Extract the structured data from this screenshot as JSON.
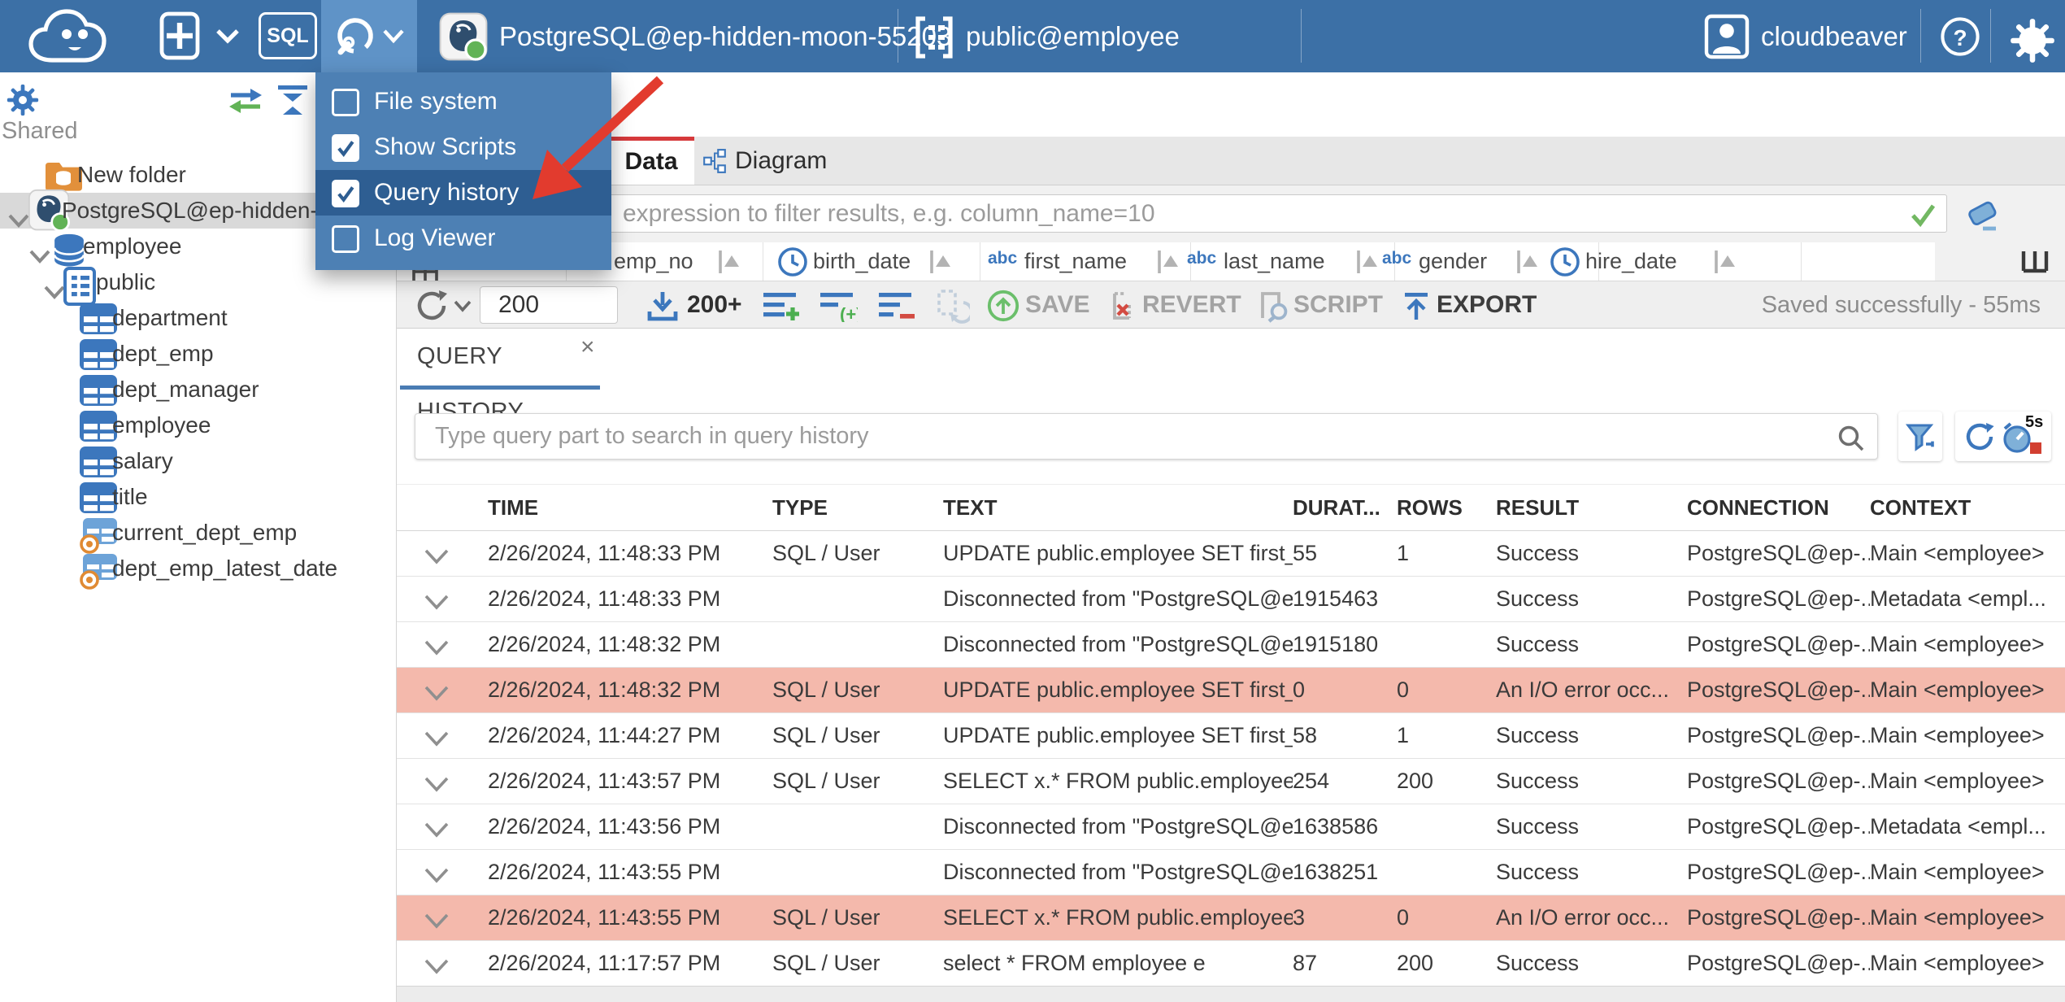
{
  "header": {
    "sql_button": "SQL",
    "connection_label": "PostgreSQL@ep-hidden-moon-55203",
    "schema_label": "public@employee",
    "user_label": "cloudbeaver"
  },
  "menu": {
    "items": [
      {
        "label": "File system",
        "checked": false,
        "highlighted": false
      },
      {
        "label": "Show Scripts",
        "checked": true,
        "highlighted": false
      },
      {
        "label": "Query history",
        "checked": true,
        "highlighted": true
      },
      {
        "label": "Log Viewer",
        "checked": false,
        "highlighted": false
      }
    ]
  },
  "sidebar": {
    "section_label": "Shared",
    "tree": [
      {
        "label": "New folder",
        "icon": "folder",
        "level": 0,
        "expander": false,
        "selected": false
      },
      {
        "label": "PostgreSQL@ep-hidden-",
        "icon": "postgres",
        "level": 0,
        "expander": true,
        "selected": true
      },
      {
        "label": "employee",
        "icon": "database",
        "level": 1,
        "expander": true,
        "selected": false
      },
      {
        "label": "public",
        "icon": "schema",
        "level": 2,
        "expander": true,
        "selected": false
      },
      {
        "label": "department",
        "icon": "table",
        "level": 3,
        "expander": false,
        "selected": false
      },
      {
        "label": "dept_emp",
        "icon": "table",
        "level": 3,
        "expander": false,
        "selected": false
      },
      {
        "label": "dept_manager",
        "icon": "table",
        "level": 3,
        "expander": false,
        "selected": false
      },
      {
        "label": "employee",
        "icon": "table",
        "level": 3,
        "expander": false,
        "selected": false
      },
      {
        "label": "salary",
        "icon": "table",
        "level": 3,
        "expander": false,
        "selected": false
      },
      {
        "label": "title",
        "icon": "table",
        "level": 3,
        "expander": false,
        "selected": false
      },
      {
        "label": "current_dept_emp",
        "icon": "view",
        "level": 3,
        "expander": false,
        "selected": false
      },
      {
        "label": "dept_emp_latest_date",
        "icon": "view",
        "level": 3,
        "expander": false,
        "selected": false
      }
    ]
  },
  "tabs": {
    "data_label": "Data",
    "diagram_label": "Diagram"
  },
  "filter": {
    "placeholder": "expression to filter results, e.g. column_name=10"
  },
  "grid": {
    "row_number_symbol": "#",
    "columns": [
      {
        "name": "emp_no",
        "type": "123"
      },
      {
        "name": "birth_date",
        "type": "date"
      },
      {
        "name": "first_name",
        "type": "abc"
      },
      {
        "name": "last_name",
        "type": "abc"
      },
      {
        "name": "gender",
        "type": "abc"
      },
      {
        "name": "hire_date",
        "type": "date"
      }
    ]
  },
  "toolbar": {
    "row_limit_value": "200",
    "fetch_size_label": "200+",
    "save_label": "SAVE",
    "revert_label": "REVERT",
    "script_label": "SCRIPT",
    "export_label": "EXPORT",
    "status_text": "Saved successfully - 55ms"
  },
  "history": {
    "tab_label": "QUERY HISTORY",
    "close_glyph": "×",
    "search_placeholder": "Type query part to search in query history",
    "timer_label": "5s",
    "columns": [
      "TIME",
      "TYPE",
      "TEXT",
      "DURAT...",
      "ROWS",
      "RESULT",
      "CONNECTION",
      "CONTEXT"
    ],
    "rows": [
      {
        "time": "2/26/2024, 11:48:33 PM",
        "type": "SQL / User",
        "text": "UPDATE public.employee SET first_...",
        "duration": "55",
        "rows": "1",
        "result": "Success",
        "connection": "PostgreSQL@ep-...",
        "context": "Main <employee>",
        "error": false
      },
      {
        "time": "2/26/2024, 11:48:33 PM",
        "type": "",
        "text": "Disconnected from \"PostgreSQL@e...",
        "duration": "1915463",
        "rows": "",
        "result": "Success",
        "connection": "PostgreSQL@ep-...",
        "context": "Metadata <empl...",
        "error": false
      },
      {
        "time": "2/26/2024, 11:48:32 PM",
        "type": "",
        "text": "Disconnected from \"PostgreSQL@e...",
        "duration": "1915180",
        "rows": "",
        "result": "Success",
        "connection": "PostgreSQL@ep-...",
        "context": "Main <employee>",
        "error": false
      },
      {
        "time": "2/26/2024, 11:48:32 PM",
        "type": "SQL / User",
        "text": "UPDATE public.employee SET first_...",
        "duration": "0",
        "rows": "0",
        "result": "An I/O error occ...",
        "connection": "PostgreSQL@ep-...",
        "context": "Main <employee>",
        "error": true
      },
      {
        "time": "2/26/2024, 11:44:27 PM",
        "type": "SQL / User",
        "text": "UPDATE public.employee SET first_...",
        "duration": "58",
        "rows": "1",
        "result": "Success",
        "connection": "PostgreSQL@ep-...",
        "context": "Main <employee>",
        "error": false
      },
      {
        "time": "2/26/2024, 11:43:57 PM",
        "type": "SQL / User",
        "text": "SELECT x.* FROM public.employee x",
        "duration": "254",
        "rows": "200",
        "result": "Success",
        "connection": "PostgreSQL@ep-...",
        "context": "Main <employee>",
        "error": false
      },
      {
        "time": "2/26/2024, 11:43:56 PM",
        "type": "",
        "text": "Disconnected from \"PostgreSQL@e...",
        "duration": "1638586",
        "rows": "",
        "result": "Success",
        "connection": "PostgreSQL@ep-...",
        "context": "Metadata <empl...",
        "error": false
      },
      {
        "time": "2/26/2024, 11:43:55 PM",
        "type": "",
        "text": "Disconnected from \"PostgreSQL@e...",
        "duration": "1638251",
        "rows": "",
        "result": "Success",
        "connection": "PostgreSQL@ep-...",
        "context": "Main <employee>",
        "error": false
      },
      {
        "time": "2/26/2024, 11:43:55 PM",
        "type": "SQL / User",
        "text": "SELECT x.* FROM public.employee x",
        "duration": "3",
        "rows": "0",
        "result": "An I/O error occ...",
        "connection": "PostgreSQL@ep-...",
        "context": "Main <employee>",
        "error": true
      },
      {
        "time": "2/26/2024, 11:17:57 PM",
        "type": "SQL / User",
        "text": "select * FROM employee e",
        "duration": "87",
        "rows": "200",
        "result": "Success",
        "connection": "PostgreSQL@ep-...",
        "context": "Main <employee>",
        "error": false
      }
    ]
  },
  "colors": {
    "header_blue": "#3c70a6",
    "menu_blue": "#4d80b4",
    "menu_selected_blue": "#2e5e92",
    "accent_blue": "#3c77bd",
    "tab_indicator_red": "#d6393b",
    "annotation_arrow_red": "#e23b2e",
    "error_row": "#f4b9ac",
    "success_green": "#72b862"
  }
}
